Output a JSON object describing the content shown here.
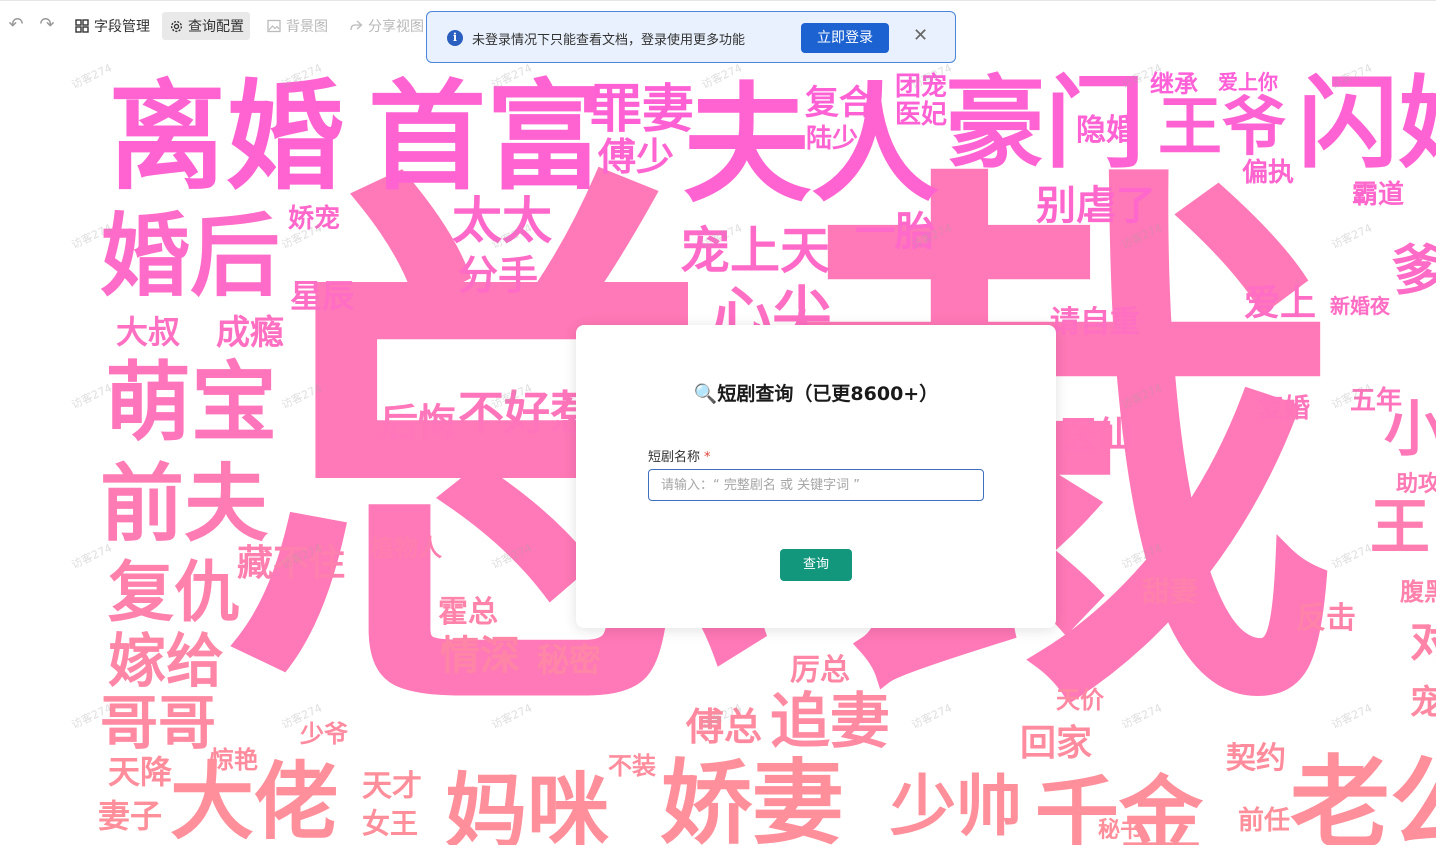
{
  "toolbar": {
    "items": [
      {
        "label": "字段管理",
        "icon": "grid-icon",
        "state": "normal"
      },
      {
        "label": "查询配置",
        "icon": "gear-icon",
        "state": "active"
      },
      {
        "label": "背景图",
        "icon": "image-icon",
        "state": "disabled"
      },
      {
        "label": "分享视图",
        "icon": "share-icon",
        "state": "disabled"
      }
    ]
  },
  "notice": {
    "message": "未登录情况下只能查看文档，登录使用更多功能",
    "login_label": "立即登录"
  },
  "dialog": {
    "title": "🔍短剧查询（已更8600+）",
    "field_label": "短剧名称",
    "required_mark": "*",
    "placeholder": "请输入：“ 完整剧名 或 关键字词 ”",
    "query_label": "查询"
  },
  "watermark": "访客274",
  "cloud": {
    "words": [
      "总裁",
      "离婚",
      "首富",
      "罪妻",
      "夫人",
      "复合",
      "团宠",
      "豪门",
      "继承",
      "爱上你",
      "闪婚",
      "傅少",
      "陆少",
      "医妃",
      "隐婚",
      "王爷",
      "偏执",
      "婚后",
      "娇宠",
      "太太",
      "一胎",
      "别虐了",
      "霸道",
      "宠上天",
      "分手",
      "星辰",
      "爹",
      "心尖",
      "大叔",
      "成瘾",
      "爱上",
      "新婚夜",
      "请自重",
      "萌宝",
      "后悔",
      "不好惹",
      "复婚",
      "五年",
      "小",
      "前夫",
      "医仙",
      "助攻",
      "王",
      "藏不住",
      "植物人",
      "复仇",
      "霍总",
      "情深",
      "秘密",
      "甜妻",
      "腹黑",
      "嫁给",
      "厉总",
      "反击",
      "哥哥",
      "追妻",
      "傅总",
      "天价",
      "宠",
      "少爷",
      "惊艳",
      "回家",
      "契约",
      "天降",
      "大佬",
      "天才",
      "女王",
      "妈咪",
      "娇妻",
      "不装",
      "少帅",
      "千金",
      "老公",
      "妻子",
      "秘书",
      "前任",
      "对"
    ]
  },
  "colors": {
    "cloud_top": "#ff5fd7",
    "cloud_bottom": "#ff8f9a",
    "login_button": "#1c62d0",
    "query_button": "#12977d",
    "banner_bg": "#e8f1fd",
    "banner_border": "#4a86d9"
  }
}
